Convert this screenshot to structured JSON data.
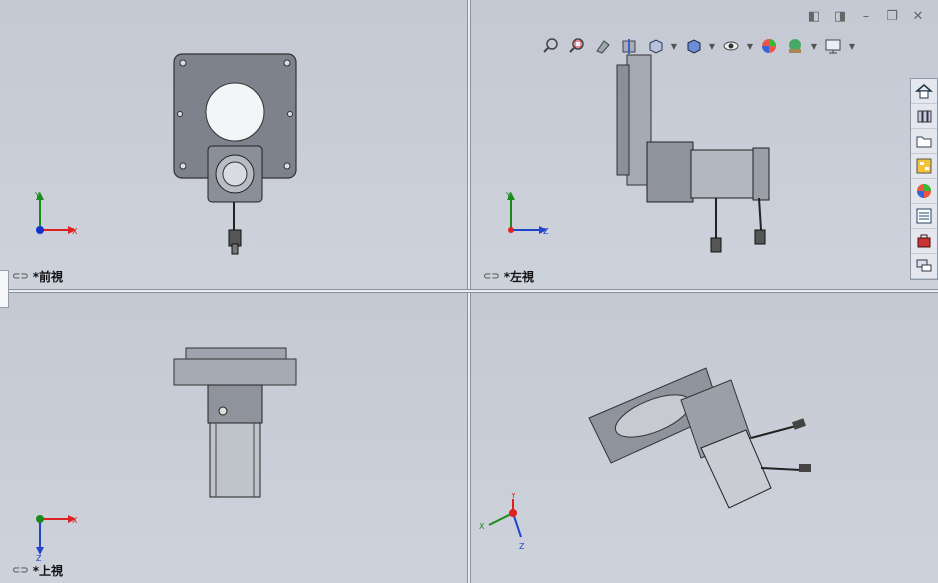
{
  "viewports": {
    "front": {
      "label": "*前視"
    },
    "left": {
      "label": "*左視"
    },
    "top": {
      "label": "*上視"
    },
    "iso": {
      "label": ""
    }
  },
  "axes": {
    "x": "X",
    "y": "Y",
    "z": "Z"
  },
  "toolbar": {
    "items": [
      "zoom-to-fit",
      "zoom-to-area",
      "previous-view",
      "section-view",
      "view-orientation",
      "display-style",
      "hide-show-items",
      "edit-appearance",
      "apply-scene",
      "view-settings"
    ]
  },
  "window_controls": [
    "prev-pane",
    "next-pane",
    "minimize",
    "restore",
    "close"
  ],
  "task_pane": [
    "home",
    "design-library",
    "file-explorer",
    "view-palette",
    "appearances",
    "custom-properties",
    "toolbox",
    "forum"
  ]
}
